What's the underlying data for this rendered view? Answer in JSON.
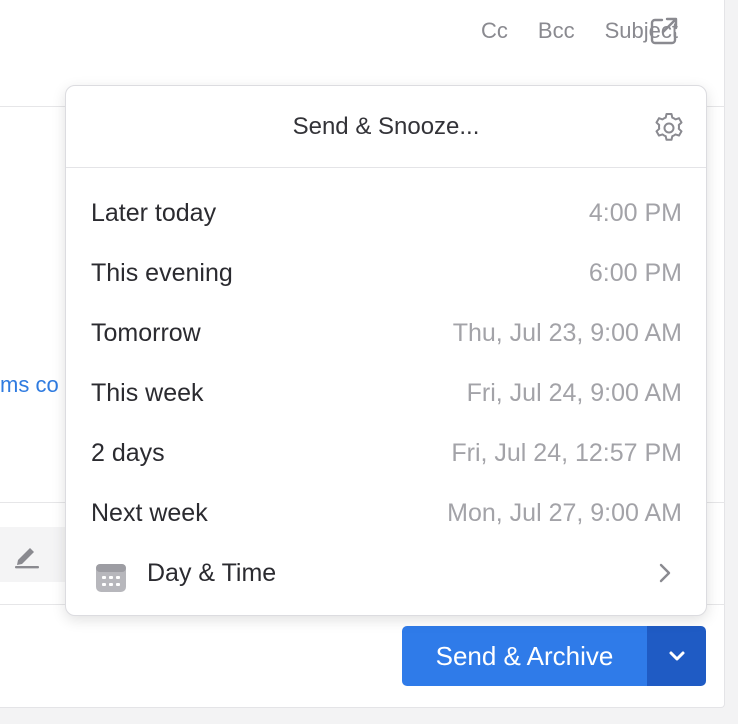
{
  "header": {
    "cc_label": "Cc",
    "bcc_label": "Bcc",
    "subject_label": "Subject"
  },
  "body": {
    "link_fragment": "ms co"
  },
  "popover": {
    "title": "Send & Snooze...",
    "options": [
      {
        "label": "Later today",
        "time": "4:00 PM"
      },
      {
        "label": "This evening",
        "time": "6:00 PM"
      },
      {
        "label": "Tomorrow",
        "time": "Thu, Jul 23, 9:00 AM"
      },
      {
        "label": "This week",
        "time": "Fri, Jul 24, 9:00 AM"
      },
      {
        "label": "2 days",
        "time": "Fri, Jul 24, 12:57 PM"
      },
      {
        "label": "Next week",
        "time": "Mon, Jul 27, 9:00 AM"
      }
    ],
    "day_time_label": "Day & Time"
  },
  "footer": {
    "send_archive_label": "Send & Archive"
  },
  "colors": {
    "accent": "#2f7be9",
    "accent_dark": "#1f5bc4",
    "link": "#2f7be0",
    "muted_text": "#a3a3a8"
  }
}
